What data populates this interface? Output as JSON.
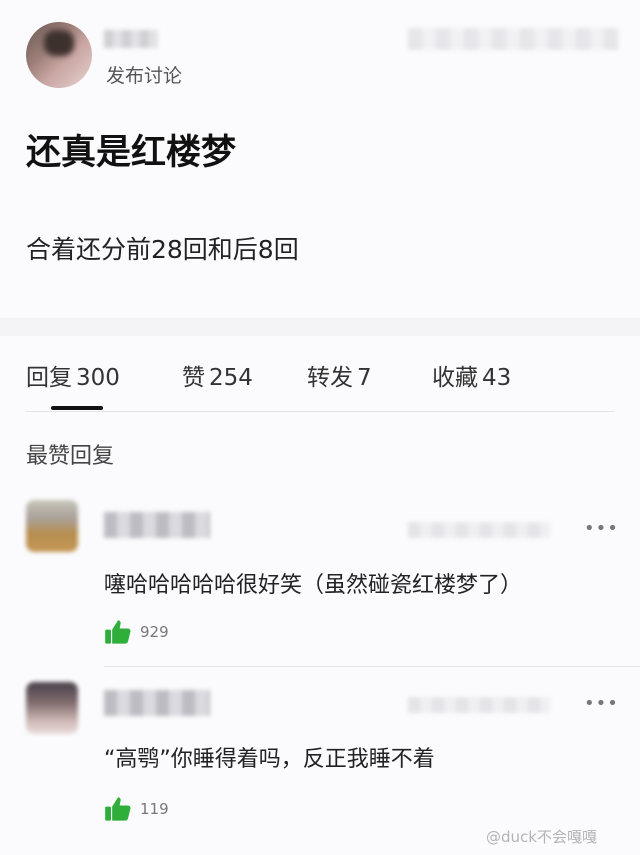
{
  "post": {
    "action_label": "发布讨论",
    "title": "还真是红楼梦",
    "body": "合着还分前28回和后8回"
  },
  "tabs": [
    {
      "label": "回复",
      "count": "300",
      "active": true
    },
    {
      "label": "赞",
      "count": "254",
      "active": false
    },
    {
      "label": "转发",
      "count": "7",
      "active": false
    },
    {
      "label": "收藏",
      "count": "43",
      "active": false
    }
  ],
  "section": {
    "heading": "最赞回复"
  },
  "replies": [
    {
      "text": "噻哈哈哈哈哈很好笑（虽然碰瓷红楼梦了）",
      "likes": "929",
      "more_icon": "more-icon"
    },
    {
      "text": "“高鹗”你睡得着吗，反正我睡不着",
      "likes": "119",
      "more_icon": "more-icon"
    }
  ],
  "icons": {
    "like": "thumbs-up-icon",
    "more": "ellipsis-icon"
  },
  "colors": {
    "like_green": "#2fae3c",
    "tab_indicator": "#111111"
  },
  "watermark": "@duck不会嘎嘎"
}
